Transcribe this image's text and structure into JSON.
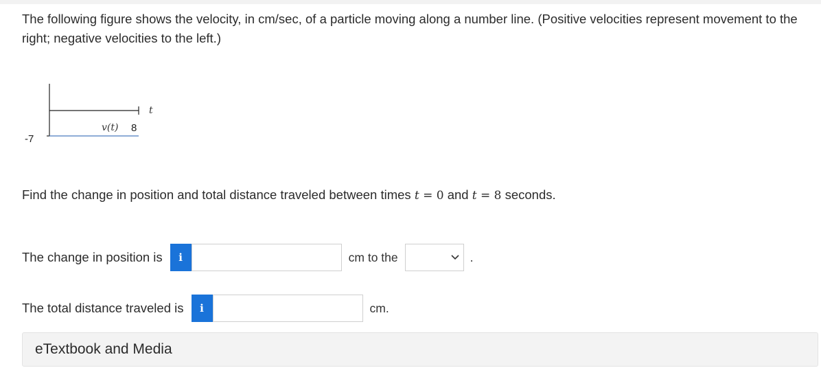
{
  "intro": {
    "text": "The following figure shows the velocity, in cm/sec, of a particle moving along a number line. (Positive velocities represent movement to the right; negative velocities to the left.)"
  },
  "figure": {
    "y_label": "-7",
    "t_label": "t",
    "v_label": "v(t)",
    "x_value_label": "8"
  },
  "question": {
    "prefix": "Find the change in position and total distance traveled between times ",
    "t1_var": "t",
    "equals": "=",
    "t1_value": "0",
    "and": "and",
    "t2_var": "t",
    "t2_value": "8",
    "suffix": "seconds."
  },
  "change_row": {
    "label": "The change in position is",
    "info_icon": "i",
    "input_value": "",
    "units": "cm to the",
    "direction_selected": "",
    "end_punct": "."
  },
  "distance_row": {
    "label": "The total distance traveled is",
    "info_icon": "i",
    "input_value": "",
    "units": "cm."
  },
  "etextbook": {
    "label": "eTextbook and Media"
  },
  "colors": {
    "info_button": "#1a73d9",
    "axis_line": "#4a7bbf"
  }
}
